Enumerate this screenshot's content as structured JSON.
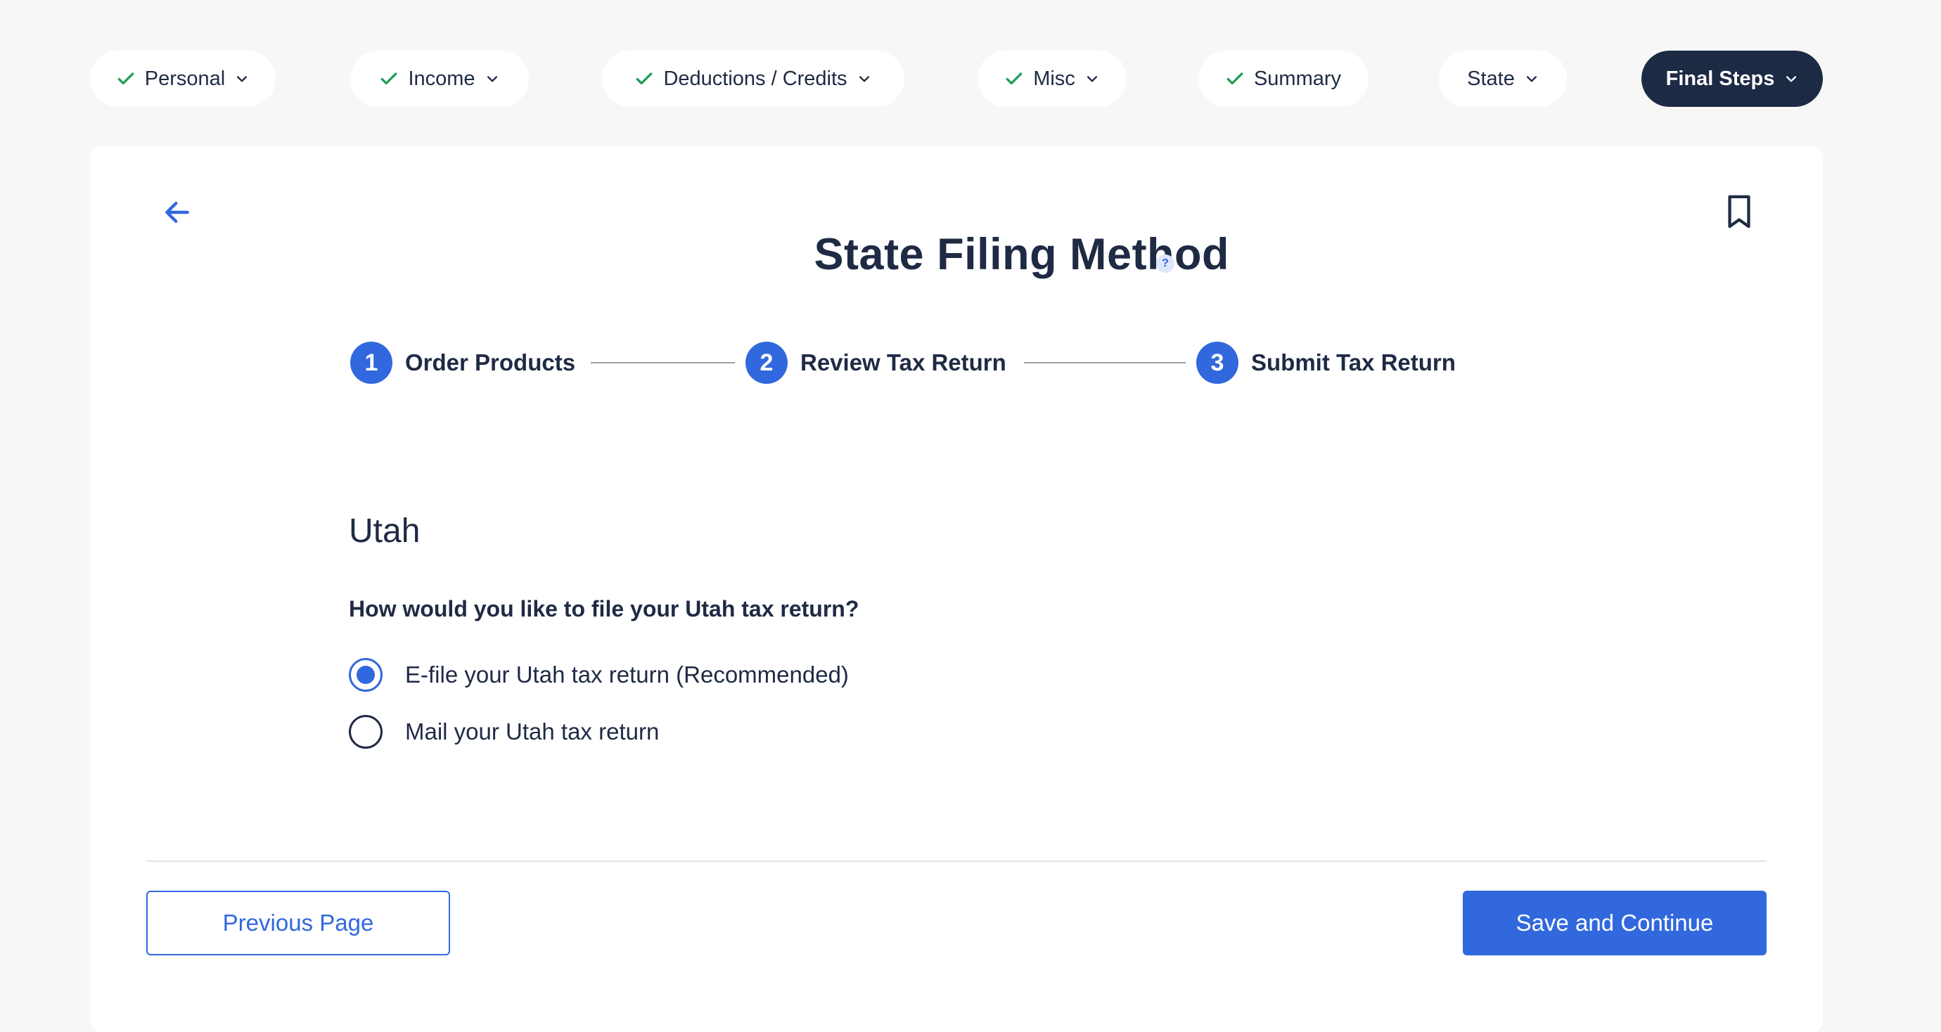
{
  "nav": {
    "items": [
      {
        "label": "Personal",
        "completed": true
      },
      {
        "label": "Income",
        "completed": true
      },
      {
        "label": "Deductions / Credits",
        "completed": true
      },
      {
        "label": "Misc",
        "completed": true
      },
      {
        "label": "Summary",
        "completed": true
      },
      {
        "label": "State",
        "completed": false
      },
      {
        "label": "Final Steps",
        "completed": false,
        "active": true
      }
    ]
  },
  "page": {
    "title": "State Filing Method",
    "help_icon_text": "?"
  },
  "stepper": {
    "steps": [
      {
        "number": "1",
        "label": "Order Products"
      },
      {
        "number": "2",
        "label": "Review Tax Return"
      },
      {
        "number": "3",
        "label": "Submit Tax Return"
      }
    ]
  },
  "form": {
    "state_name": "Utah",
    "question": "How would you like to file your Utah tax return?",
    "options": [
      {
        "label": "E-file your Utah tax return (Recommended)",
        "selected": true
      },
      {
        "label": "Mail your Utah tax return",
        "selected": false
      }
    ]
  },
  "footer": {
    "previous_label": "Previous Page",
    "save_label": "Save and Continue"
  },
  "colors": {
    "accent": "#3268dd",
    "check_green": "#1f9d55",
    "navy": "#1d2a44"
  }
}
